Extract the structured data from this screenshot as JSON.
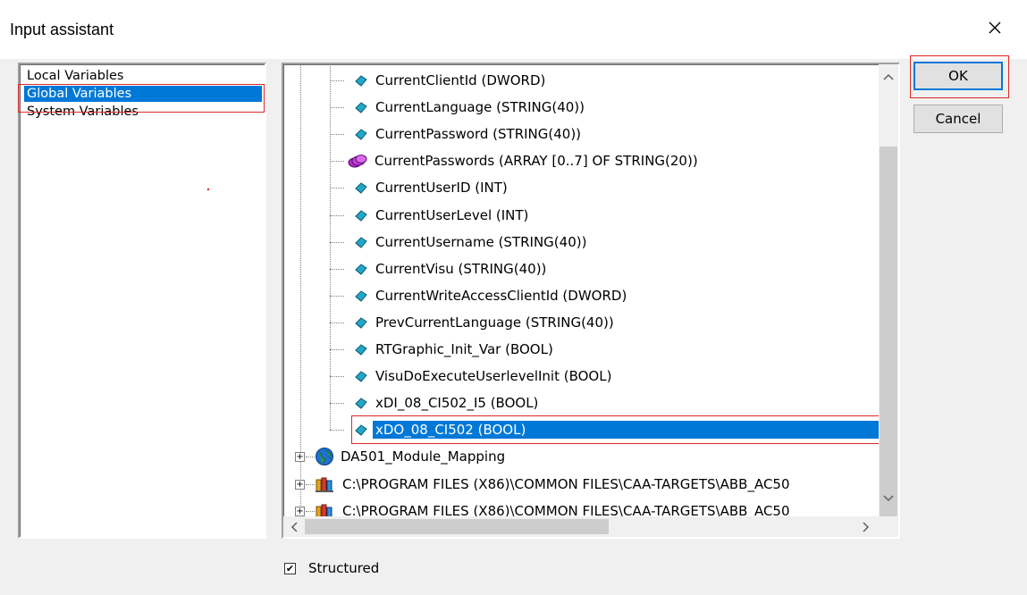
{
  "window": {
    "title": "Input assistant",
    "close_glyph": "✕"
  },
  "categories": [
    {
      "label": "Local Variables"
    },
    {
      "label": "Global Variables"
    },
    {
      "label": "System Variables"
    }
  ],
  "tree": {
    "items": [
      {
        "label": "CurrentClientId (DWORD)",
        "icon": "variable-icon"
      },
      {
        "label": "CurrentLanguage (STRING(40))",
        "icon": "variable-icon"
      },
      {
        "label": "CurrentPassword (STRING(40))",
        "icon": "variable-icon"
      },
      {
        "label": "CurrentPasswords (ARRAY [0..7] OF STRING(20))",
        "icon": "array-icon"
      },
      {
        "label": "CurrentUserID (INT)",
        "icon": "variable-icon"
      },
      {
        "label": "CurrentUserLevel (INT)",
        "icon": "variable-icon"
      },
      {
        "label": "CurrentUsername (STRING(40))",
        "icon": "variable-icon"
      },
      {
        "label": "CurrentVisu (STRING(40))",
        "icon": "variable-icon"
      },
      {
        "label": "CurrentWriteAccessClientId (DWORD)",
        "icon": "variable-icon"
      },
      {
        "label": "PrevCurrentLanguage (STRING(40))",
        "icon": "variable-icon"
      },
      {
        "label": "RTGraphic_Init_Var (BOOL)",
        "icon": "variable-icon"
      },
      {
        "label": "VisuDoExecuteUserlevelInit (BOOL)",
        "icon": "variable-icon"
      },
      {
        "label": "xDI_08_CI502_I5 (BOOL)",
        "icon": "variable-icon"
      },
      {
        "label": "xDO_08_CI502 (BOOL)",
        "icon": "variable-icon"
      }
    ],
    "groups": [
      {
        "label": "DA501_Module_Mapping",
        "icon": "globe-icon",
        "expander": "+"
      },
      {
        "label": "C:\\PROGRAM FILES (X86)\\COMMON FILES\\CAA-TARGETS\\ABB_AC50",
        "icon": "library-icon",
        "expander": "+"
      },
      {
        "label": "C:\\PROGRAM FILES (X86)\\COMMON FILES\\CAA-TARGETS\\ABB_AC50",
        "icon": "library-icon",
        "expander": "+"
      }
    ]
  },
  "buttons": {
    "ok": "OK",
    "cancel": "Cancel"
  },
  "structured": {
    "label": "Structured",
    "checked": true,
    "check_glyph": "✔"
  },
  "colors": {
    "selection": "#0078d7",
    "highlight_box": "#e0282a"
  }
}
